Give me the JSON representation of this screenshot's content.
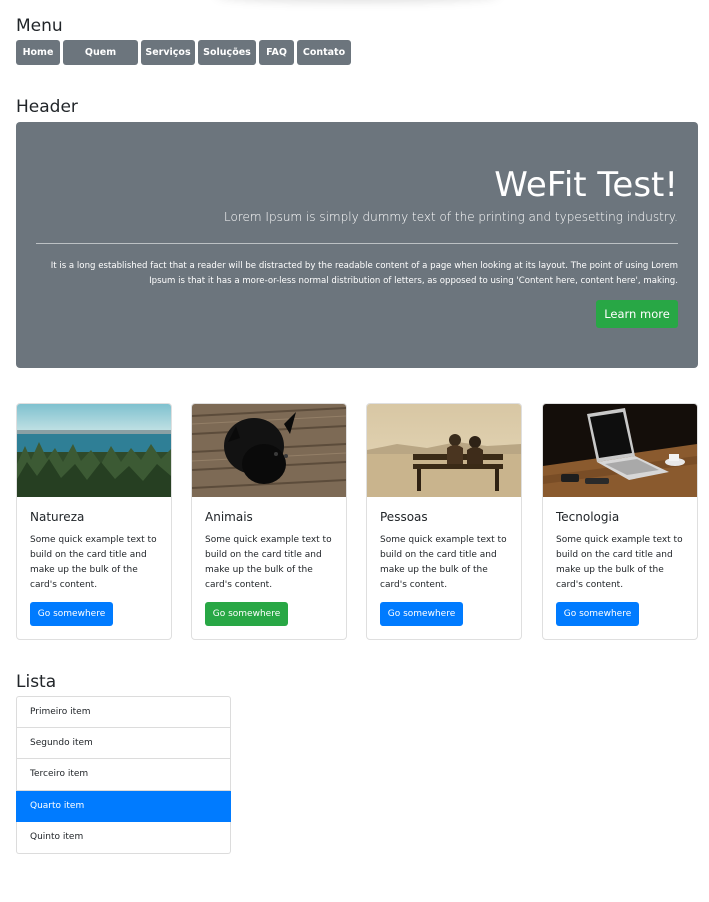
{
  "menu": {
    "heading": "Menu",
    "items": [
      "Home",
      "Quem",
      "Serviços",
      "Soluções",
      "FAQ",
      "Contato"
    ]
  },
  "header": {
    "heading": "Header",
    "title": "WeFit Test!",
    "lead": "Lorem Ipsum is simply dummy text of the printing and typesetting industry.",
    "body": "It is a long established fact that a reader will be distracted by the readable content of a page when looking at its layout. The point of using Lorem Ipsum is that it has a more-or-less normal distribution of letters, as opposed to using 'Content here, content here', making.",
    "button": "Learn more"
  },
  "cards": [
    {
      "title": "Natureza",
      "text": "Some quick example text to build on the card title and make up the bulk of the card's content.",
      "button": "Go somewhere",
      "button_color": "#007bff",
      "image": "forest-lake-image"
    },
    {
      "title": "Animais",
      "text": "Some quick example text to build on the card title and make up the bulk of the card's content.",
      "button": "Go somewhere",
      "button_color": "#28a745",
      "image": "black-dog-image"
    },
    {
      "title": "Pessoas",
      "text": "Some quick example text to build on the card title and make up the bulk of the card's content.",
      "button": "Go somewhere",
      "button_color": "#007bff",
      "image": "couple-bench-image"
    },
    {
      "title": "Tecnologia",
      "text": "Some quick example text to build on the card title and make up the bulk of the card's content.",
      "button": "Go somewhere",
      "button_color": "#007bff",
      "image": "laptop-desk-image"
    }
  ],
  "list": {
    "heading": "Lista",
    "items": [
      "Primeiro item",
      "Segundo item",
      "Terceiro item",
      "Quarto item",
      "Quinto item"
    ],
    "active_item": "Quarto item"
  },
  "colors": {
    "secondary": "#6c757d",
    "success": "#28a745",
    "primary": "#007bff"
  }
}
